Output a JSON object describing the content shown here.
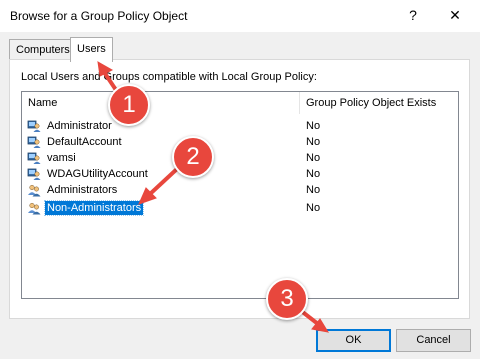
{
  "window": {
    "title": "Browse for a Group Policy Object",
    "help_label": "?",
    "close_label": "✕"
  },
  "tabs": [
    {
      "label": "Computers",
      "active": false
    },
    {
      "label": "Users",
      "active": true
    }
  ],
  "panel": {
    "description": "Local Users and Groups compatible with Local Group Policy:"
  },
  "list": {
    "columns": [
      "Name",
      "Group Policy Object Exists"
    ],
    "rows": [
      {
        "name": "Administrator",
        "exists": "No",
        "icon": "user-icon"
      },
      {
        "name": "DefaultAccount",
        "exists": "No",
        "icon": "user-icon"
      },
      {
        "name": "vamsi",
        "exists": "No",
        "icon": "user-icon"
      },
      {
        "name": "WDAGUtilityAccount",
        "exists": "No",
        "icon": "user-icon"
      },
      {
        "name": "Administrators",
        "exists": "No",
        "icon": "group-icon"
      },
      {
        "name": "Non-Administrators",
        "exists": "No",
        "icon": "group-icon",
        "selected": true
      }
    ]
  },
  "buttons": {
    "ok": "OK",
    "cancel": "Cancel"
  },
  "annotations": {
    "step1": "1",
    "step2": "2",
    "step3": "3",
    "color": "#e8473d"
  }
}
